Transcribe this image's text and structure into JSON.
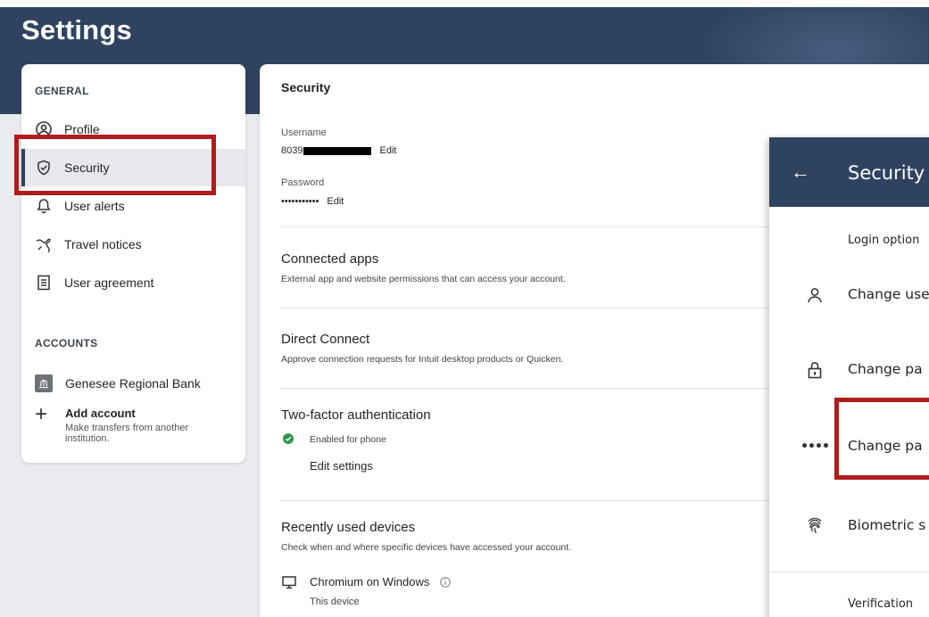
{
  "page": {
    "title": "Settings"
  },
  "sidebar": {
    "general_label": "GENERAL",
    "items": [
      {
        "label": "Profile",
        "icon": "profile-icon"
      },
      {
        "label": "Security",
        "icon": "shield-icon",
        "active": true
      },
      {
        "label": "User alerts",
        "icon": "bell-icon"
      },
      {
        "label": "Travel notices",
        "icon": "plane-icon"
      },
      {
        "label": "User agreement",
        "icon": "document-icon"
      }
    ],
    "accounts_label": "ACCOUNTS",
    "bank": {
      "label": "Genesee Regional Bank",
      "icon": "bank-icon"
    },
    "add_account": {
      "label": "Add account",
      "sub": "Make transfers from another institution."
    }
  },
  "main": {
    "title": "Security",
    "username": {
      "label": "Username",
      "value": "8039",
      "edit": "Edit"
    },
    "password": {
      "label": "Password",
      "value": "•••••••••••",
      "edit": "Edit"
    },
    "connected_apps": {
      "title": "Connected apps",
      "desc": "External app and website permissions that can access your account."
    },
    "direct_connect": {
      "title": "Direct Connect",
      "desc": "Approve connection requests for Intuit desktop products or Quicken."
    },
    "two_factor": {
      "title": "Two-factor authentication",
      "status": "Enabled for phone",
      "edit": "Edit settings"
    },
    "devices": {
      "title": "Recently used devices",
      "desc": "Check when and where specific devices have accessed your account.",
      "device_name": "Chromium on Windows",
      "device_sub": "This device"
    }
  },
  "phone": {
    "title": "Security",
    "login_options": "Login option",
    "rows": [
      {
        "label": "Change use",
        "icon": "person-icon"
      },
      {
        "label": "Change pa",
        "icon": "lock-icon"
      },
      {
        "label": "Change pa",
        "icon": "dots-icon"
      },
      {
        "label": "Biometric s",
        "icon": "fingerprint-icon"
      }
    ],
    "verification": "Verification"
  },
  "colors": {
    "header": "#2f4360",
    "annotation": "#b01c1c",
    "success": "#2e9a4f"
  }
}
